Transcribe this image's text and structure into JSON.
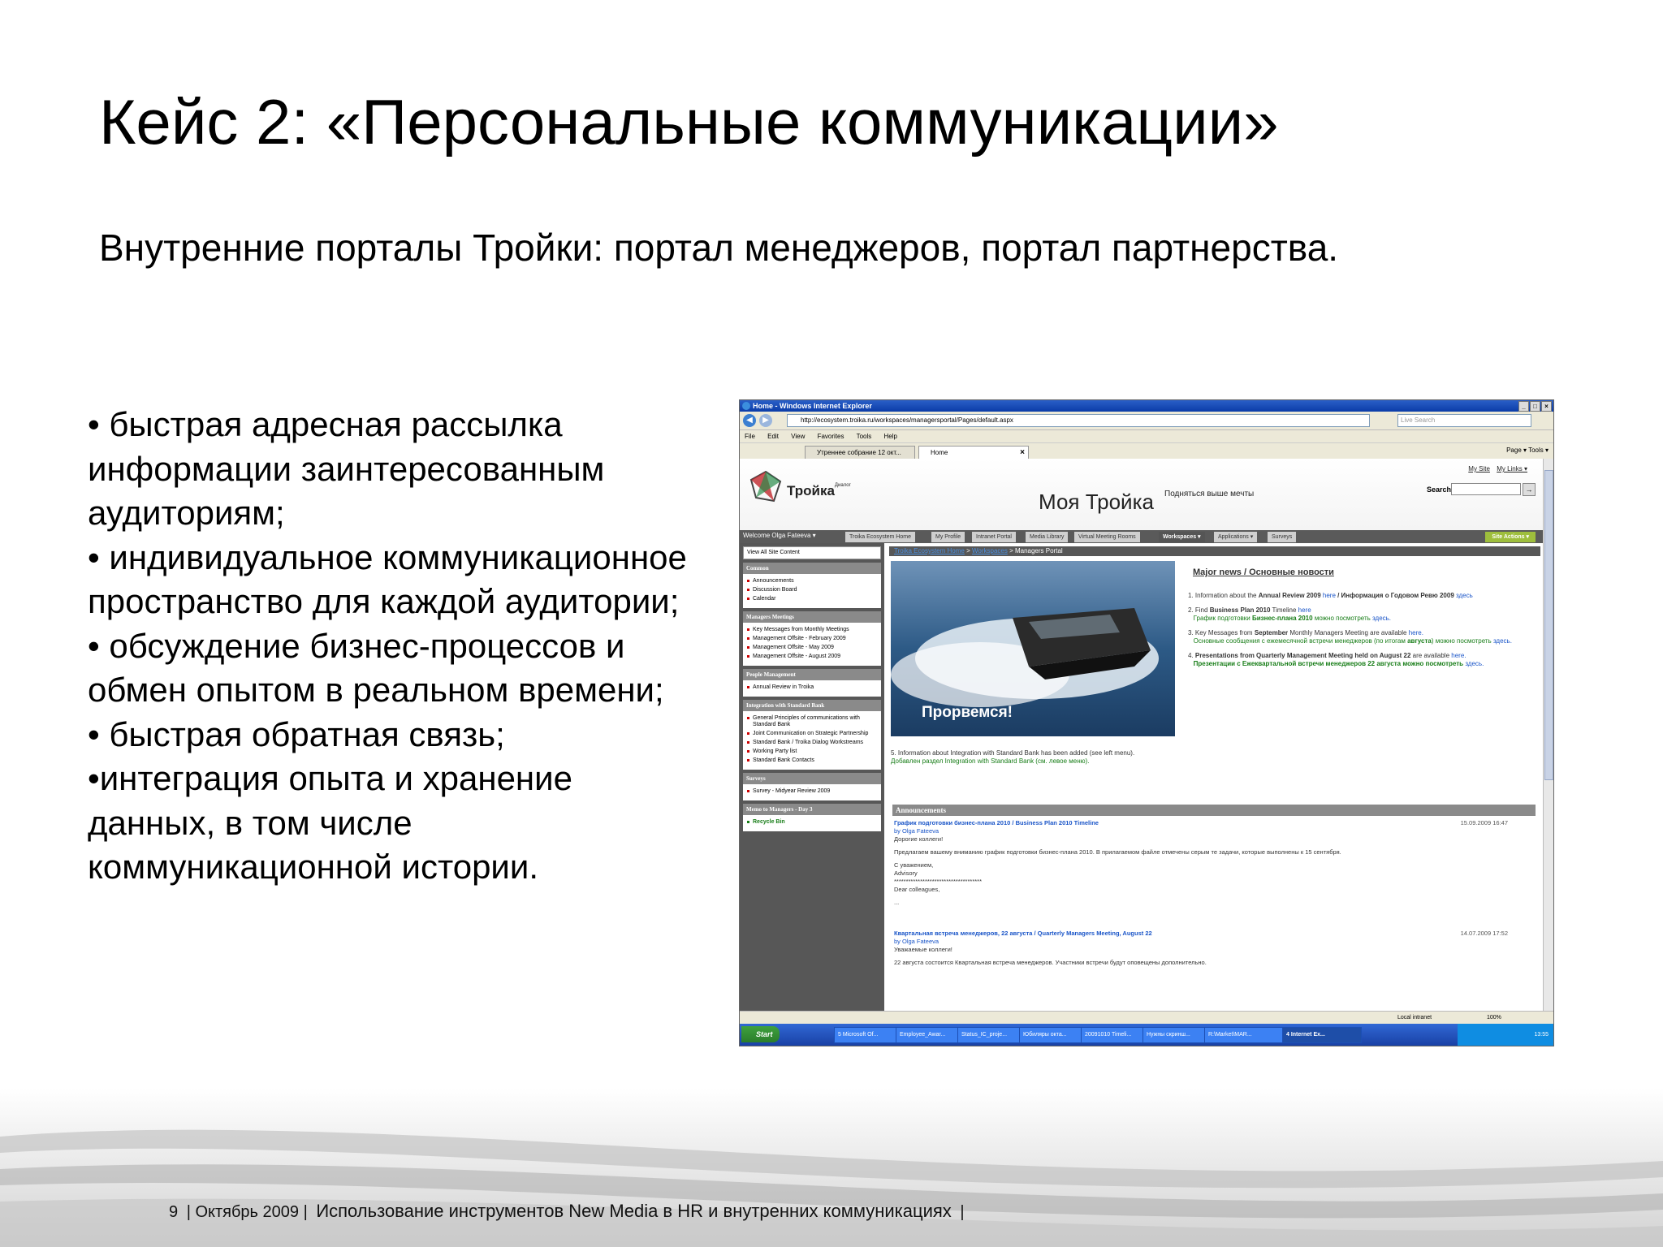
{
  "slide": {
    "title": "Кейс 2: «Персональные коммуникации»",
    "subtitle": "Внутренние порталы Тройки: портал менеджеров, портал партнерства.",
    "bullets": [
      "• быстрая адресная рассылка информации заинтересованным аудиториям;",
      "• индивидуальное коммуникационное пространство для каждой аудитории;",
      "• обсуждение бизнес-процессов и обмен опытом в реальном времени;",
      "• быстрая обратная связь;",
      "•интеграция опыта и хранение данных, в том числе коммуникационной истории."
    ]
  },
  "footer": {
    "page": "9",
    "date": "| Октябрь 2009 |",
    "text": "Использование инструментов New Media в HR и внутренних коммуникациях",
    "end": "|"
  },
  "screenshot": {
    "window_title": "Home - Windows Internet Explorer",
    "address": "http://ecosystem.troika.ru/workspaces/managersportal/Pages/default.aspx",
    "search_placeholder": "Live Search",
    "menu": [
      "File",
      "Edit",
      "View",
      "Favorites",
      "Tools",
      "Help"
    ],
    "tabs": [
      "Утреннее собрание 12 окт...",
      "Home"
    ],
    "toolbar_right": "Page ▾   Tools ▾",
    "header": {
      "logo": "Тройка",
      "logo_small": "Диалог",
      "site_title": "Моя Тройка",
      "tagline": "Подняться выше мечты",
      "my_site": "My Site",
      "my_links": "My Links ▾",
      "search_label": "Search"
    },
    "nav": {
      "welcome": "Welcome Olga Fateeva ▾",
      "tabs": [
        "Troika Ecosystem Home",
        "My Profile",
        "Intranet Portal",
        "Media Library",
        "Virtual Meeting Rooms",
        "Workspaces ▾",
        "Applications ▾",
        "Surveys"
      ],
      "site_actions": "Site Actions ▾"
    },
    "leftnav": {
      "view_all": "View All Site Content",
      "sections": [
        {
          "title": "Common",
          "items": [
            "Announcements",
            "Discussion Board",
            "Calendar"
          ]
        },
        {
          "title": "Managers Meetings",
          "items": [
            "Key Messages from Monthly Meetings",
            "Management Offsite - February 2009",
            "Management Offsite - May 2009",
            "Management Offsite - August 2009"
          ]
        },
        {
          "title": "People Management",
          "items": [
            "Annual Review in Troika"
          ]
        },
        {
          "title": "Integration with Standard Bank",
          "items": [
            "General Principles of communications with Standard Bank",
            "Joint Communication on Strategic Partnership",
            "Standard Bank / Troika Dialog Workstreams",
            "Working Party list",
            "Standard Bank Contacts"
          ]
        },
        {
          "title": "Surveys",
          "items": [
            "Survey - Midyear Review 2009"
          ]
        },
        {
          "title": "Memo to Managers - Day 3",
          "items": [
            "Recycle Bin"
          ]
        }
      ]
    },
    "breadcrumb": {
      "a": "Troika Ecosystem Home",
      "b": "Workspaces",
      "c": "Managers Portal"
    },
    "image_caption": "Прорвемся!",
    "news": {
      "title": "Major news / Основные новости",
      "items": [
        {
          "a": "1. Information about the ",
          "b": "Annual Review 2009",
          "c": " here",
          "d": " / Информация о Годовом Ревю 2009 ",
          "e": "здесь"
        },
        {
          "a": "2. Find ",
          "b": "Business Plan 2010",
          "c": " Timeline ",
          "d": "here",
          "e": "График подготовки ",
          "f": "Бизнес-плана 2010",
          "g": " можно посмотреть ",
          "h": "здесь."
        },
        {
          "a": "3. Key Messages from ",
          "b": "September",
          "c": " Monthly Managers Meeting are available ",
          "d": "here.",
          "e": "Основные сообщения с ежемесячной встречи менеджеров (по итогам ",
          "f": "августа",
          "g": ") можно посмотреть ",
          "h": "здесь."
        },
        {
          "a": "4. ",
          "b": "Presentations from Quarterly Management Meeting held on August 22",
          "c": " are available ",
          "d": "here.",
          "e": "Презентации с Ежеквартальной встречи менеджеров 22 августа можно посмотреть ",
          "f": "здесь."
        }
      ],
      "item5_en": "5. Information about Integration with Standard Bank has been added (see left menu).",
      "item5_ru": "Добавлен раздел Integration with Standard Bank (см. левое меню)."
    },
    "announcements": {
      "title": "Announcements",
      "posts": [
        {
          "title": "График подготовки бизнес-плана 2010 / Business Plan 2010 Timeline",
          "by": "by Olga Fateeva",
          "date": "15.09.2009 16:47",
          "l1": "Дорогие коллеги!",
          "l2": "Предлагаем вашему вниманию график подготовки бизнес-плана 2010. В прилагаемом файле отмечены серым те задачи, которые выполнены к 15 сентября.",
          "l3": "С уважением,",
          "l4": "Advisory",
          "l5": "*************************************",
          "l6": "Dear colleagues,",
          "l7": "..."
        },
        {
          "title": "Квартальная встреча менеджеров, 22 августа / Quarterly Managers Meeting, August 22",
          "by": "by Olga Fateeva",
          "date": "14.07.2009 17:52",
          "l1": "Уважаемые коллеги!",
          "l2": "22 августа состоится Квартальная встреча менеджеров. Участники встречи будут оповещены дополнительно."
        }
      ]
    },
    "status": {
      "zone": "Local intranet",
      "zoom": "100%"
    },
    "taskbar": {
      "start": "Start",
      "items": [
        "5 Microsoft Of...",
        "Employee_Awar...",
        "Status_IC_proje...",
        "Юбиляры окта...",
        "20091010 Timeli...",
        "Нужны скринш...",
        "R:\\Market\\MAR...",
        "4 Internet Ex..."
      ],
      "time": "13:55"
    }
  }
}
